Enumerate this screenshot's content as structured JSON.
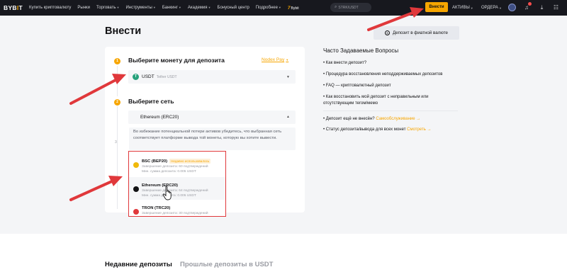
{
  "topnav": {
    "logo_main": "BYB",
    "logo_bar": "I",
    "logo_end": "T",
    "items": [
      "Купить криптовалюту",
      "Рынки",
      "Торговать",
      "Инструменты",
      "Банкинг",
      "Академия",
      "Бонусный центр",
      "Подробнее"
    ],
    "promo": "7",
    "promo_sub": "Bybit",
    "search_placeholder": "STRK/USDT",
    "deposit_label": "Внести",
    "assets_label": "АКТИВЫ",
    "orders_label": "ОРДЕРА"
  },
  "page": {
    "title": "Внести",
    "fiat_button": "Депозит в фиатной валюте"
  },
  "step1": {
    "number": "1",
    "label": "Выберите монету для депозита",
    "nodex_link": "Nodex Pay",
    "coin_symbol": "USDT",
    "coin_name": "Tether USDT",
    "coin_icon": "T"
  },
  "step2": {
    "number": "2",
    "label": "Выберите сеть",
    "selected_network": "Ethereum (ERC20)",
    "warning": "Во избежание потенциальной потери активов убедитесь, что выбранная сеть соответствует платформе вывода той монеты, которую вы хотите вывести."
  },
  "step3": {
    "number": "3"
  },
  "networks": [
    {
      "name": "BSC (BEP20)",
      "tag": "Недавно использовалось",
      "confirmations": "Завершение депозита: 60 подтверждений",
      "min_deposit": "Мин. сумма депозита: 0.005 USDT",
      "color": "#f0b90b"
    },
    {
      "name": "Ethereum (ERC20)",
      "tag": "",
      "confirmations": "Завершение депозита: 64 подтверждений",
      "min_deposit": "Мин. сумма депозита: 0.005 USDT",
      "color": "#121214"
    },
    {
      "name": "TRON (TRC20)",
      "tag": "",
      "confirmations": "Завершение депозита: 30 подтверждений",
      "min_deposit": "",
      "color": "#e0383b"
    }
  ],
  "faq": {
    "title": "Часто Задаваемые Вопросы",
    "items": [
      "Как внести депозит?",
      "Процедура восстановления неподдерживаемых депозитов",
      "FAQ — криптовалютный депозит",
      "Как восстановить мой депозит с неправильным или отсутствующим тегом/мемо"
    ],
    "not_received": "Депозит ещё не внесён?",
    "self_service": "Самообслуживание",
    "status_text": "Статус депозита/вывода для всех монет",
    "status_link": "Смотреть"
  },
  "bottom_tabs": {
    "recent": "Недавние депозиты",
    "past": "Прошлые депозиты в USDT"
  },
  "colors": {
    "accent": "#f7a600",
    "annotation": "#e0383b"
  }
}
